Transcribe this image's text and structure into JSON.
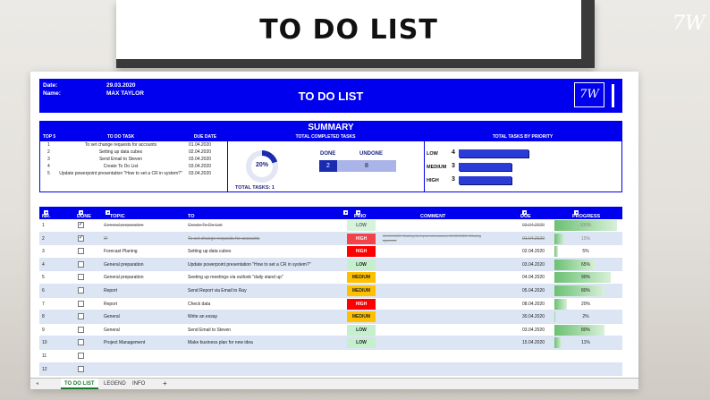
{
  "banner": {
    "title": "TO DO LIST"
  },
  "header": {
    "date_label": "Date:",
    "date_value": "29.03.2020",
    "name_label": "Name:",
    "name_value": "MAX TAYLOR",
    "title": "TO DO LIST"
  },
  "summary": {
    "title": "SUMMARY",
    "top5_header": [
      "TOP 5",
      "TO DO TASK",
      "DUE DATE"
    ],
    "top5": [
      {
        "n": "1",
        "task": "To set change requests for accounts",
        "due": "01.04.2020"
      },
      {
        "n": "2",
        "task": "Setting up data cubes",
        "due": "02.04.2020"
      },
      {
        "n": "3",
        "task": "Send Email to Steven",
        "due": "03.04.2020"
      },
      {
        "n": "4",
        "task": "Create To Do List",
        "due": "03.04.2020"
      },
      {
        "n": "5",
        "task": "Update powerpoint presentation \"How to set a CR in system?\"",
        "due": "03.04.2020"
      }
    ],
    "completed_header": "TOTAL COMPLETED TASKS",
    "completed_pct": "20%",
    "completed_fraction": 0.2,
    "total_tasks_label": "TOTAL TASKS:",
    "total_tasks": "1",
    "done_label": "DONE",
    "undone_label": "UNDONE",
    "done_count": "2",
    "undone_count": "8",
    "priority_header": "TOTAL TASKS BY PRIORITY",
    "priority": [
      {
        "label": "LOW",
        "count": "4",
        "value": 4
      },
      {
        "label": "MEDIUM",
        "count": "3",
        "value": 3
      },
      {
        "label": "HIGH",
        "count": "3",
        "value": 3
      }
    ]
  },
  "table": {
    "headers": [
      "NR.",
      "DONE",
      "TOPIC",
      "TO DO TASK",
      "PRIO",
      "COMMENT HISTORY",
      "DUE DATE",
      "PROGRESS (%)"
    ],
    "rows": [
      {
        "nr": "1",
        "done": true,
        "topic": "General preparation",
        "task": "Create To Do List",
        "prio": "LOW",
        "comment": "",
        "due": "03.04.2020",
        "progress": "100%",
        "pct": 100
      },
      {
        "nr": "2",
        "done": true,
        "topic": "IT",
        "task": "To set change requests for accounts",
        "prio": "HIGH",
        "comment": "01.04.2020: Waiting for input information; 14.03.2020: Missing approval",
        "due": "01.04.2020",
        "progress": "15%",
        "pct": 15
      },
      {
        "nr": "3",
        "done": false,
        "topic": "Forecast Planing",
        "task": "Setting up data cubes",
        "prio": "HIGH",
        "comment": "",
        "due": "02.04.2020",
        "progress": "5%",
        "pct": 5
      },
      {
        "nr": "4",
        "done": false,
        "topic": "General preparation",
        "task": "Update powerpoint presentation \"How to set a CR in system?\"",
        "prio": "LOW",
        "comment": "",
        "due": "03.04.2020",
        "progress": "65%",
        "pct": 65
      },
      {
        "nr": "5",
        "done": false,
        "topic": "General preparation",
        "task": "Seeting up meetings via outlook \"daily stand up\"",
        "prio": "MEDIUM",
        "comment": "",
        "due": "04.04.2020",
        "progress": "90%",
        "pct": 90
      },
      {
        "nr": "6",
        "done": false,
        "topic": "Report",
        "task": "Send Report via Email to Ray",
        "prio": "MEDIUM",
        "comment": "",
        "due": "05.04.2020",
        "progress": "80%",
        "pct": 80
      },
      {
        "nr": "7",
        "done": false,
        "topic": "Report",
        "task": "Check data",
        "prio": "HIGH",
        "comment": "",
        "due": "08.04.2020",
        "progress": "20%",
        "pct": 20
      },
      {
        "nr": "8",
        "done": false,
        "topic": "General",
        "task": "Write an essay",
        "prio": "MEDIUM",
        "comment": "",
        "due": "30.04.2020",
        "progress": "2%",
        "pct": 2
      },
      {
        "nr": "9",
        "done": false,
        "topic": "General",
        "task": "Send Email to Steven",
        "prio": "LOW",
        "comment": "",
        "due": "03.04.2020",
        "progress": "80%",
        "pct": 80
      },
      {
        "nr": "10",
        "done": false,
        "topic": "Project Management",
        "task": "Make business plan for new idea",
        "prio": "LOW",
        "comment": "",
        "due": "15.04.2020",
        "progress": "11%",
        "pct": 11
      },
      {
        "nr": "11",
        "done": false,
        "topic": "",
        "task": "",
        "prio": "",
        "comment": "",
        "due": "",
        "progress": "",
        "pct": 0
      },
      {
        "nr": "12",
        "done": false,
        "topic": "",
        "task": "",
        "prio": "",
        "comment": "",
        "due": "",
        "progress": "",
        "pct": 0
      }
    ]
  },
  "prio_colors": {
    "LOW": "#c6efce",
    "MEDIUM": "#ffc000",
    "HIGH": "#ff0000"
  },
  "tabs": [
    "TO DO LIST",
    "LEGEND",
    "INFO"
  ],
  "tab_add": "+"
}
